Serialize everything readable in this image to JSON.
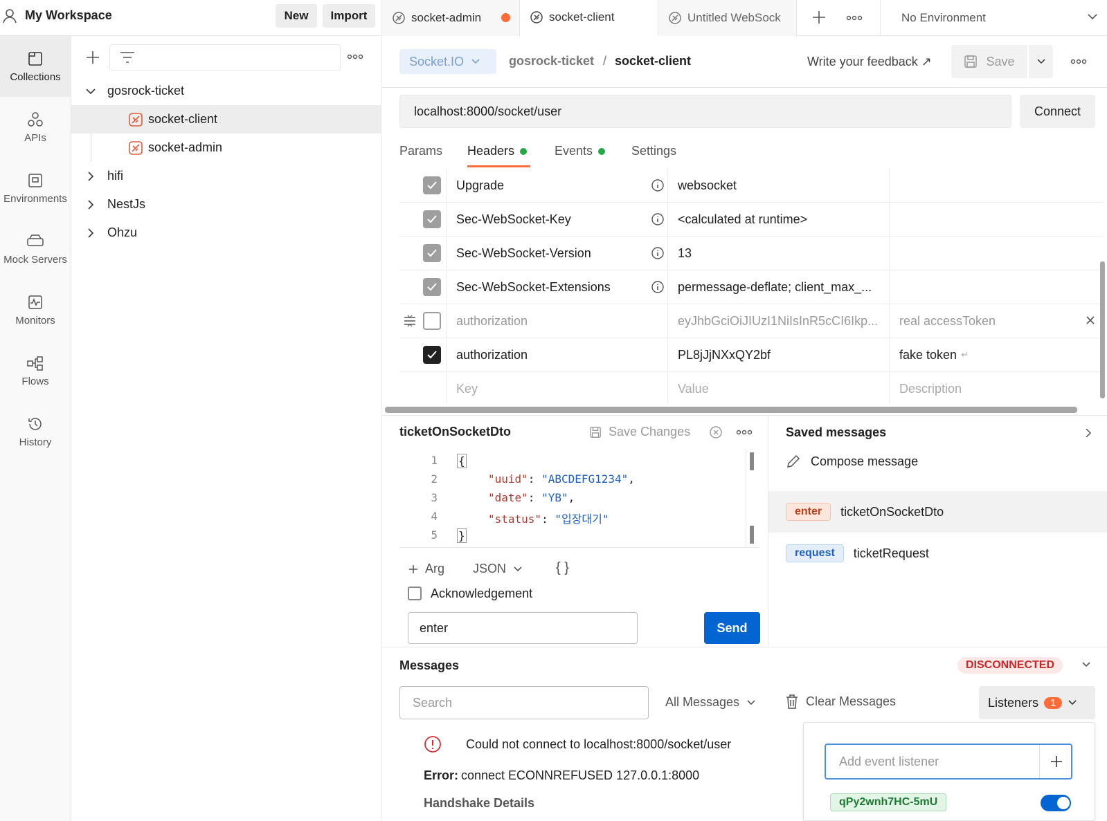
{
  "workspace": {
    "title": "My Workspace",
    "new_label": "New",
    "import_label": "Import"
  },
  "tabs": [
    {
      "label": "socket-admin",
      "unsaved": true
    },
    {
      "label": "socket-client",
      "unsaved": false
    },
    {
      "label": "Untitled WebSock",
      "unsaved": false
    }
  ],
  "environment": {
    "selected": "No Environment"
  },
  "rail": [
    {
      "label": "Collections"
    },
    {
      "label": "APIs"
    },
    {
      "label": "Environments"
    },
    {
      "label": "Mock Servers"
    },
    {
      "label": "Monitors"
    },
    {
      "label": "Flows"
    },
    {
      "label": "History"
    }
  ],
  "tree": {
    "collection": "gosrock-ticket",
    "requests": [
      "socket-client",
      "socket-admin"
    ],
    "folders": [
      "hifi",
      "NestJs",
      "Ohzu"
    ]
  },
  "request": {
    "type": "Socket.IO",
    "breadcrumb_collection": "gosrock-ticket",
    "breadcrumb_sep": "/",
    "breadcrumb_request": "socket-client",
    "feedback": "Write your feedback ↗",
    "save_label": "Save",
    "url": "localhost:8000/socket/user",
    "connect_label": "Connect"
  },
  "subtabs": {
    "params": "Params",
    "headers": "Headers",
    "events": "Events",
    "settings": "Settings"
  },
  "headers": [
    {
      "key": "Upgrade",
      "value": "websocket",
      "desc": ""
    },
    {
      "key": "Sec-WebSocket-Key",
      "value": "<calculated at runtime>",
      "desc": ""
    },
    {
      "key": "Sec-WebSocket-Version",
      "value": "13",
      "desc": ""
    },
    {
      "key": "Sec-WebSocket-Extensions",
      "value": "permessage-deflate; client_max_...",
      "desc": ""
    },
    {
      "key": "authorization",
      "value": "eyJhbGciOiJIUzI1NiIsInR5cCI6Ikp...",
      "desc": "real accessToken"
    },
    {
      "key": "authorization",
      "value": "PL8jJjNXxQY2bf",
      "desc": "fake token"
    }
  ],
  "headers_placeholder": {
    "key": "Key",
    "value": "Value",
    "desc": "Description"
  },
  "composer": {
    "title": "ticketOnSocketDto",
    "save_changes": "Save Changes",
    "lines": [
      "1",
      "2",
      "3",
      "4",
      "5"
    ],
    "code": {
      "open": "{",
      "k1": "\"uuid\"",
      "v1": "\"ABCDEFG1234\"",
      "k2": "\"date\"",
      "v2": "\"YB\"",
      "k3": "\"status\"",
      "v3": "\"입장대기\"",
      "close": "}"
    },
    "arg_label": "Arg",
    "format": "JSON",
    "braces": "{ }",
    "ack_label": "Acknowledgement",
    "event_value": "enter",
    "send_label": "Send"
  },
  "saved": {
    "title": "Saved messages",
    "compose_label": "Compose message",
    "items": [
      {
        "event": "enter",
        "name": "ticketOnSocketDto"
      },
      {
        "event": "request",
        "name": "ticketRequest"
      }
    ]
  },
  "messages": {
    "title": "Messages",
    "status": "DISCONNECTED",
    "search_placeholder": "Search",
    "filter": "All Messages",
    "clear_label": "Clear Messages",
    "listeners_label": "Listeners",
    "listeners_count": "1",
    "error_title": "Could not connect to localhost:8000/socket/user",
    "error_prefix": "Error:",
    "error_detail": "connect ECONNREFUSED 127.0.0.1:8000",
    "handshake_label": "Handshake Details",
    "listener_placeholder": "Add event listener",
    "listener_name": "qPy2wnh7HC-5mU",
    "listener_enabled": true
  },
  "colors": {
    "accent": "#ff6c37",
    "primary": "#0265d2",
    "error": "#d32f2f",
    "green": "#28a745"
  }
}
